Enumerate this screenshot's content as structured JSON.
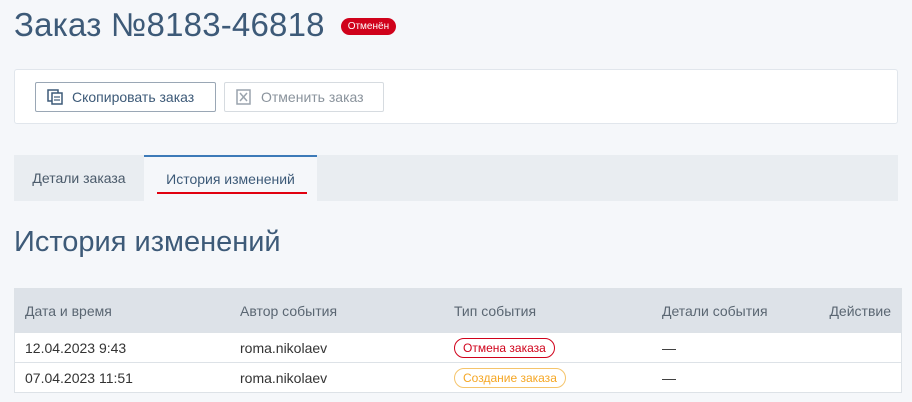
{
  "header": {
    "title": "Заказ №8183-46818",
    "status": "Отменён",
    "status_color": "#d0021b"
  },
  "toolbar": {
    "copy_label": "Скопировать заказ",
    "cancel_label": "Отменить заказ"
  },
  "tabs": [
    {
      "label": "Детали заказа",
      "active": false
    },
    {
      "label": "История изменений",
      "active": true
    }
  ],
  "section": {
    "title": "История изменений"
  },
  "table": {
    "headers": [
      "Дата и время",
      "Автор события",
      "Тип события",
      "Детали события",
      "Действие"
    ],
    "rows": [
      {
        "datetime": "12.04.2023 9:43",
        "author": "roma.nikolaev",
        "type": "Отмена заказа",
        "details": "—",
        "type_color": "#d0021b"
      },
      {
        "datetime": "07.04.2023 11:51",
        "author": "roma.nikolaev",
        "type": "Создание заказа",
        "details": "—",
        "type_color": "#f5a623"
      }
    ]
  },
  "colors": {
    "accent": "#3d5a78",
    "tab_underline": "#e1000f",
    "background": "#f5f7fa"
  }
}
